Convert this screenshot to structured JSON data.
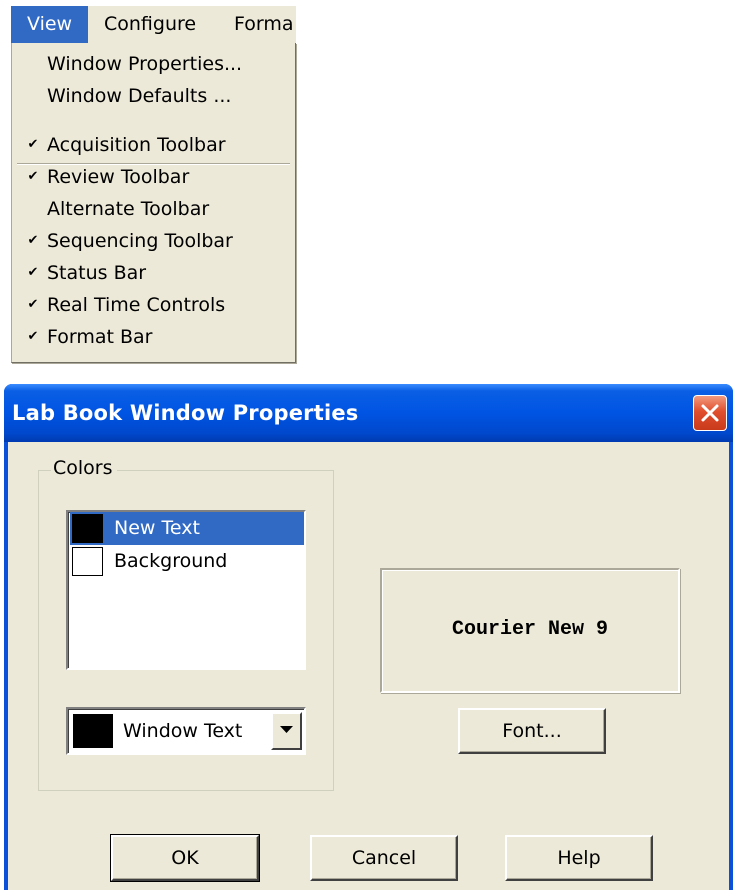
{
  "menubar": {
    "items": [
      {
        "label": "View",
        "active": true
      },
      {
        "label": "Configure",
        "active": false
      },
      {
        "label": "Forma",
        "active": false
      }
    ]
  },
  "view_menu": {
    "items": [
      {
        "label": "Window Properties...",
        "checked": false
      },
      {
        "label": "Window Defaults ...",
        "checked": false
      },
      {
        "label": "Acquisition Toolbar",
        "checked": true
      },
      {
        "label": "Review Toolbar",
        "checked": true
      },
      {
        "label": "Alternate Toolbar",
        "checked": false
      },
      {
        "label": "Sequencing Toolbar",
        "checked": true
      },
      {
        "label": "Status Bar",
        "checked": true
      },
      {
        "label": "Real Time Controls",
        "checked": true
      },
      {
        "label": "Format Bar",
        "checked": true
      }
    ],
    "check_glyph": "✔"
  },
  "dialog": {
    "title": "Lab Book Window Properties",
    "close_icon": "close-icon",
    "colors_group": {
      "label": "Colors",
      "list": [
        {
          "label": "New Text",
          "swatch": "#000000",
          "selected": true
        },
        {
          "label": "Background",
          "swatch": "#ffffff",
          "selected": false
        }
      ],
      "combo": {
        "value": "Window Text",
        "swatch": "#000000"
      }
    },
    "preview_text": "Courier New 9",
    "buttons": {
      "font": "Font...",
      "ok": "OK",
      "cancel": "Cancel",
      "help": "Help"
    }
  },
  "colors": {
    "titlebar": "#0054e3",
    "face": "#ece9d8",
    "selection": "#316ac5",
    "close": "#e04f2e"
  }
}
